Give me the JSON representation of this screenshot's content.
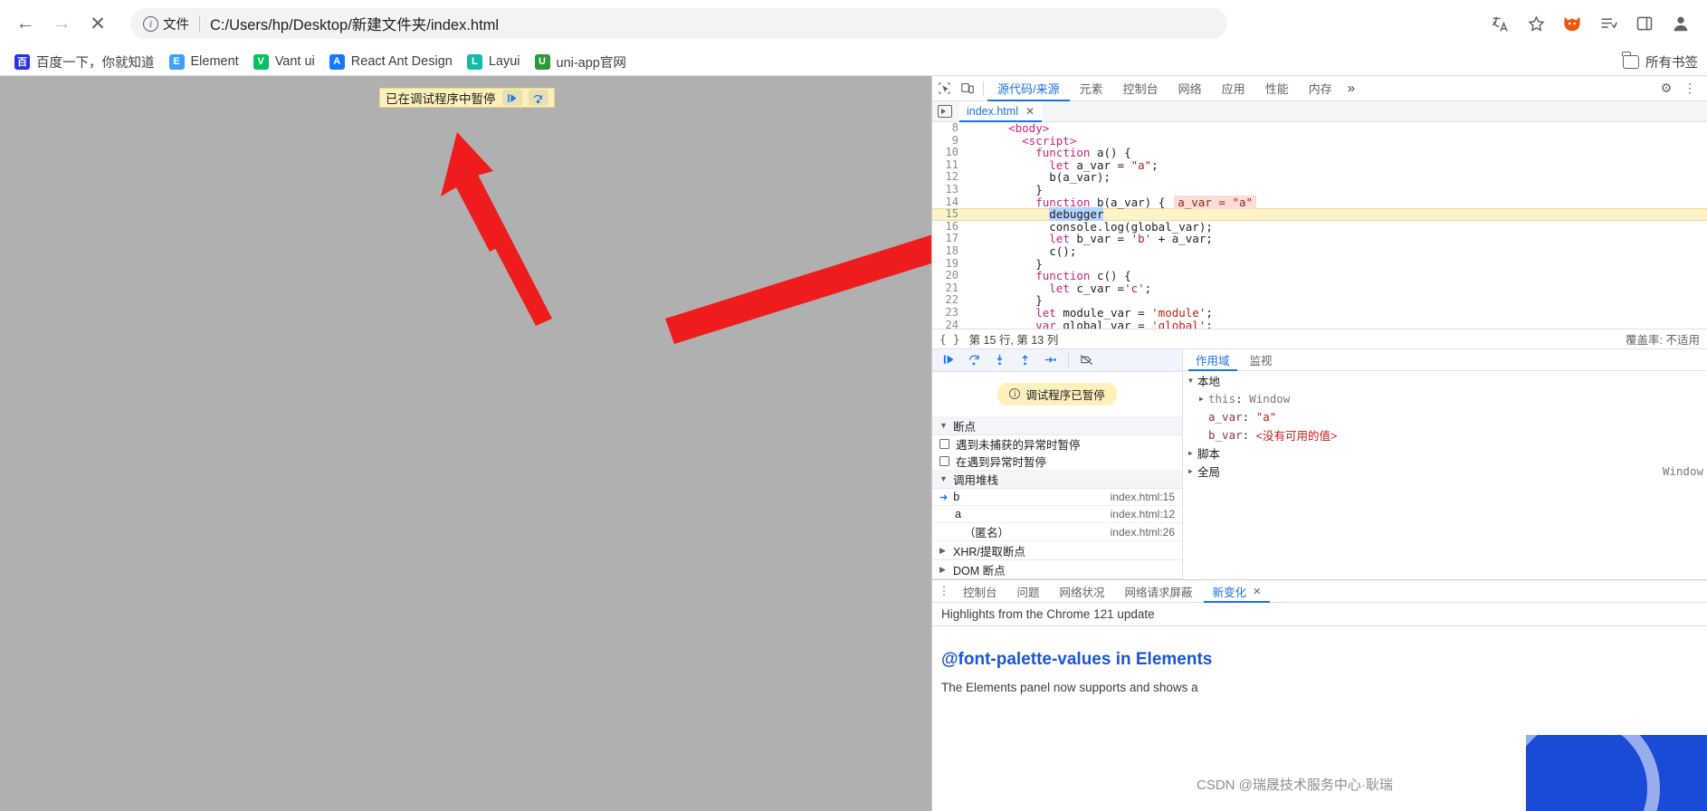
{
  "browser": {
    "nav": {
      "back": "←",
      "forward": "→",
      "stop": "✕"
    },
    "omnibox": {
      "scheme_label": "文件",
      "url": "C:/Users/hp/Desktop/新建文件夹/index.html",
      "info_glyph": "i"
    },
    "toolbar_right": [
      {
        "name": "translate-icon",
        "glyph": "文"
      },
      {
        "name": "bookmark-star-icon",
        "glyph": "☆"
      },
      {
        "name": "extension-fox-icon",
        "glyph": "🦊"
      },
      {
        "name": "reading-list-icon",
        "glyph": "≔"
      },
      {
        "name": "side-panel-icon",
        "glyph": "▯"
      },
      {
        "name": "profile-avatar-icon",
        "glyph": "👤"
      }
    ],
    "bookmarks": [
      {
        "label": "百度一下，你就知道",
        "mark": "百",
        "color": "#2932e1"
      },
      {
        "label": "Element",
        "mark": "E",
        "color": "#409eff"
      },
      {
        "label": "Vant ui",
        "mark": "V",
        "color": "#07c160"
      },
      {
        "label": "React Ant Design",
        "mark": "A",
        "color": "#1677ff"
      },
      {
        "label": "Layui",
        "mark": "L",
        "color": "#16baaa"
      },
      {
        "label": "uni-app官网",
        "mark": "U",
        "color": "#2b9939"
      }
    ],
    "bookmarks_right_label": "所有书签"
  },
  "page_overlay": {
    "paused_bar_text": "已在调试程序中暂停",
    "resume_glyph": "❙▶",
    "step_glyph": "↷"
  },
  "devtools": {
    "tabs": [
      {
        "label": "源代码/来源",
        "active": true
      },
      {
        "label": "元素",
        "active": false
      },
      {
        "label": "控制台",
        "active": false
      },
      {
        "label": "网络",
        "active": false
      },
      {
        "label": "应用",
        "active": false
      },
      {
        "label": "性能",
        "active": false
      },
      {
        "label": "内存",
        "active": false
      }
    ],
    "more_tabs_glyph": "»",
    "settings_glyph": "⚙",
    "kebab_glyph": "⋮",
    "inspect_icon": "inspect-element-icon",
    "device_icon": "device-toolbar-icon",
    "file_tab": {
      "label": "index.html",
      "close": "✕"
    },
    "editor": {
      "lines": [
        {
          "no": "8",
          "parts": [
            {
              "t": "    ",
              "c": "op"
            },
            {
              "t": "<body>",
              "c": "kw"
            }
          ],
          "highlight": false,
          "clipped": true
        },
        {
          "no": "9",
          "parts": [
            {
              "t": "      ",
              "c": "op"
            },
            {
              "t": "<script>",
              "c": "kw"
            }
          ],
          "highlight": false
        },
        {
          "no": "10",
          "parts": [
            {
              "t": "        ",
              "c": "op"
            },
            {
              "t": "function",
              "c": "kw"
            },
            {
              "t": " a() {",
              "c": "op"
            }
          ],
          "highlight": false
        },
        {
          "no": "11",
          "parts": [
            {
              "t": "          ",
              "c": "op"
            },
            {
              "t": "let",
              "c": "kw"
            },
            {
              "t": " a_var = ",
              "c": "op"
            },
            {
              "t": "\"a\"",
              "c": "str"
            },
            {
              "t": ";",
              "c": "op"
            }
          ],
          "highlight": false
        },
        {
          "no": "12",
          "parts": [
            {
              "t": "          b(a_var);",
              "c": "op"
            }
          ],
          "highlight": false
        },
        {
          "no": "13",
          "parts": [
            {
              "t": "        }",
              "c": "op"
            }
          ],
          "highlight": false
        },
        {
          "no": "14",
          "parts": [
            {
              "t": "        ",
              "c": "op"
            },
            {
              "t": "function",
              "c": "kw"
            },
            {
              "t": " b(a_var) {",
              "c": "op"
            },
            {
              "t": "a_var = \"a\"",
              "c": "hint"
            }
          ],
          "highlight": false
        },
        {
          "no": "15",
          "parts": [
            {
              "t": "          ",
              "c": "op"
            },
            {
              "t": "debugger",
              "c": "sel"
            }
          ],
          "highlight": true
        },
        {
          "no": "16",
          "parts": [
            {
              "t": "          console.log(global_var);",
              "c": "op"
            }
          ],
          "highlight": false
        },
        {
          "no": "17",
          "parts": [
            {
              "t": "          ",
              "c": "op"
            },
            {
              "t": "let",
              "c": "kw"
            },
            {
              "t": " b_var = ",
              "c": "op"
            },
            {
              "t": "'b'",
              "c": "str"
            },
            {
              "t": " + a_var;",
              "c": "op"
            }
          ],
          "highlight": false
        },
        {
          "no": "18",
          "parts": [
            {
              "t": "          c();",
              "c": "op"
            }
          ],
          "highlight": false
        },
        {
          "no": "19",
          "parts": [
            {
              "t": "        }",
              "c": "op"
            }
          ],
          "highlight": false
        },
        {
          "no": "20",
          "parts": [
            {
              "t": "        ",
              "c": "op"
            },
            {
              "t": "function",
              "c": "kw"
            },
            {
              "t": " c() {",
              "c": "op"
            }
          ],
          "highlight": false
        },
        {
          "no": "21",
          "parts": [
            {
              "t": "          ",
              "c": "op"
            },
            {
              "t": "let",
              "c": "kw"
            },
            {
              "t": " c_var =",
              "c": "op"
            },
            {
              "t": "'c'",
              "c": "str"
            },
            {
              "t": ";",
              "c": "op"
            }
          ],
          "highlight": false
        },
        {
          "no": "22",
          "parts": [
            {
              "t": "        }",
              "c": "op"
            }
          ],
          "highlight": false
        },
        {
          "no": "23",
          "parts": [
            {
              "t": "        ",
              "c": "op"
            },
            {
              "t": "let",
              "c": "kw"
            },
            {
              "t": " module_var = ",
              "c": "op"
            },
            {
              "t": "'module'",
              "c": "str"
            },
            {
              "t": ";",
              "c": "op"
            }
          ],
          "highlight": false
        },
        {
          "no": "24",
          "parts": [
            {
              "t": "        ",
              "c": "op"
            },
            {
              "t": "var",
              "c": "kw"
            },
            {
              "t": " global_var = ",
              "c": "op"
            },
            {
              "t": "'global'",
              "c": "str"
            },
            {
              "t": ";",
              "c": "op"
            }
          ],
          "highlight": false,
          "clipped": true
        }
      ],
      "status": {
        "braces": "{ }",
        "position": "第 15 行, 第 13 列",
        "coverage": "覆盖率: 不适用"
      }
    },
    "debug_toolbar": [
      {
        "name": "resume-script-button",
        "glyph": "❙▷"
      },
      {
        "name": "step-over-button",
        "glyph": "↷"
      },
      {
        "name": "step-into-button",
        "glyph": "↓"
      },
      {
        "name": "step-out-button",
        "glyph": "↑"
      },
      {
        "name": "step-button",
        "glyph": "→•"
      },
      {
        "name": "deactivate-breakpoints-button",
        "glyph": "⃠"
      }
    ],
    "paused_message": "调试程序已暂停",
    "breakpoints": {
      "header": "断点",
      "options": [
        {
          "label": "遇到未捕获的异常时暂停",
          "checked": false
        },
        {
          "label": "在遇到异常时暂停",
          "checked": false
        }
      ]
    },
    "call_stack": {
      "header": "调用堆栈",
      "frames": [
        {
          "name": "b",
          "location": "index.html:15",
          "current": true
        },
        {
          "name": "a",
          "location": "index.html:12",
          "current": false
        },
        {
          "name": "（匿名）",
          "location": "index.html:26",
          "current": false
        }
      ]
    },
    "extra_sections": [
      {
        "label": "XHR/提取断点"
      },
      {
        "label": "DOM 断点"
      }
    ],
    "scope": {
      "tabs": [
        {
          "label": "作用域",
          "active": true
        },
        {
          "label": "监视",
          "active": false
        }
      ],
      "groups": [
        {
          "label": "本地",
          "expanded": true,
          "rows": [
            {
              "expandable": true,
              "key": "this",
              "sep": ": ",
              "value": "Window",
              "key_class": "sc-this",
              "value_class": "sc-this"
            },
            {
              "expandable": false,
              "key": "a_var",
              "sep": ": ",
              "value": "\"a\"",
              "key_class": "sc-key",
              "value_class": "sc-str"
            },
            {
              "expandable": false,
              "key": "b_var",
              "sep": ": ",
              "value": "<没有可用的值>",
              "key_class": "sc-key",
              "value_class": "sc-missing"
            }
          ]
        },
        {
          "label": "脚本",
          "expanded": false,
          "rows": []
        },
        {
          "label": "全局",
          "expanded": false,
          "rows": [],
          "right": "Window"
        }
      ]
    },
    "drawer": {
      "kebab": "⋮",
      "tabs": [
        {
          "label": "控制台",
          "active": false,
          "closable": false
        },
        {
          "label": "问题",
          "active": false,
          "closable": false
        },
        {
          "label": "网络状况",
          "active": false,
          "closable": false
        },
        {
          "label": "网络请求屏蔽",
          "active": false,
          "closable": false
        },
        {
          "label": "新变化",
          "active": true,
          "closable": true,
          "close": "✕"
        }
      ],
      "whats_new": {
        "subtitle": "Highlights from the Chrome 121 update",
        "title": "@font-palette-values in Elements",
        "body": "The Elements panel now supports and shows a"
      }
    }
  },
  "watermark": "CSDN @瑞晟技术服务中心·耿瑞"
}
